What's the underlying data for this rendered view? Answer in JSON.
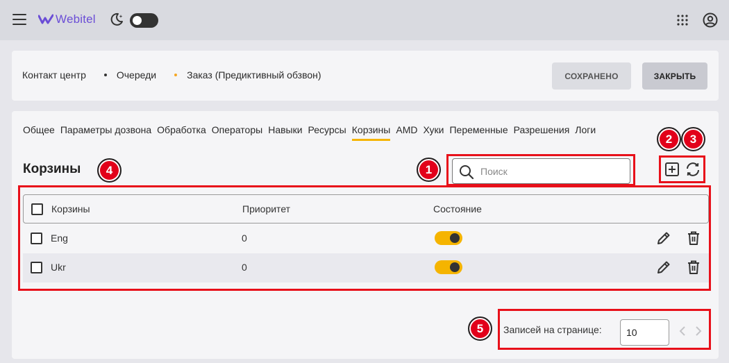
{
  "header": {
    "logo_text": "Webitel",
    "icons": [
      "menu-icon",
      "webitel-logo-icon",
      "moon-icon",
      "apps-grid-icon",
      "account-icon"
    ]
  },
  "breadcrumb": {
    "items": [
      "Контакт центр",
      "Очереди",
      "Заказ (Предиктивный обзвон)"
    ]
  },
  "actions": {
    "saved_label": "СОХРАНЕНО",
    "close_label": "ЗАКРЫТЬ"
  },
  "tabs": {
    "items": [
      "Общее",
      "Параметры дозвона",
      "Обработка",
      "Операторы",
      "Навыки",
      "Ресурсы",
      "Корзины",
      "AMD",
      "Хуки",
      "Переменные",
      "Разрешения",
      "Логи"
    ],
    "active": "Корзины"
  },
  "section": {
    "title": "Корзины"
  },
  "search": {
    "placeholder": "Поиск",
    "value": ""
  },
  "table": {
    "columns": [
      "Корзины",
      "Приоритет",
      "Состояние"
    ],
    "rows": [
      {
        "name": "Eng",
        "priority": "0",
        "enabled": true
      },
      {
        "name": "Ukr",
        "priority": "0",
        "enabled": true
      }
    ]
  },
  "pagination": {
    "label": "Записей на странице:",
    "per_page": "10"
  },
  "annotations": [
    "1",
    "2",
    "3",
    "4",
    "5"
  ],
  "colors": {
    "accent": "#f5b400",
    "annotation_red": "#e8101a",
    "logo_purple": "#6b4ed6"
  }
}
